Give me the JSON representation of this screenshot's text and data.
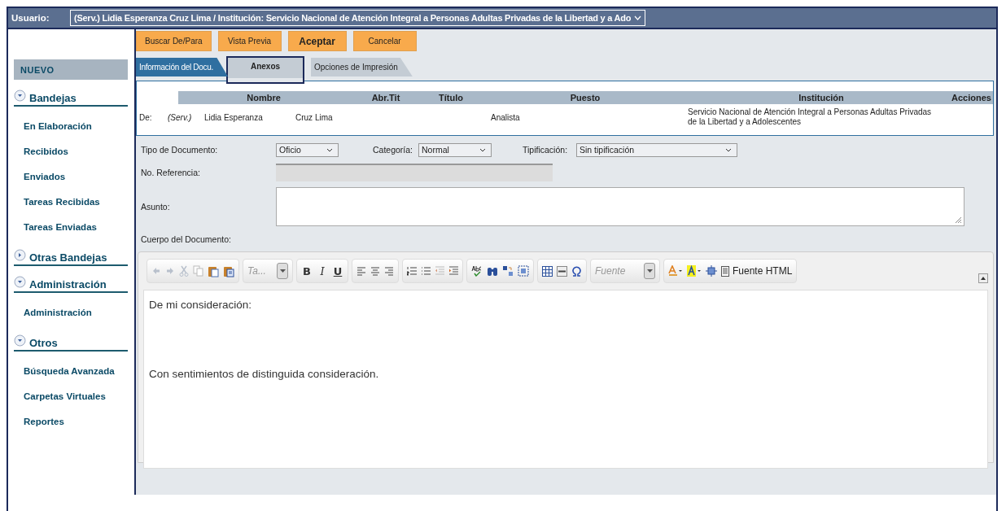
{
  "header": {
    "label": "Usuario:",
    "user_select": "(Serv.) Lidia Esperanza Cruz Lima / Institución: Servicio Nacional de Atención Integral a Personas Adultas Privadas de la Libertad y a Ado"
  },
  "sidebar": {
    "new_button": "NUEVO",
    "sections": [
      {
        "title": "Bandejas",
        "expanded": true,
        "items": [
          "En Elaboración",
          "Recibidos",
          "Enviados",
          "Tareas Recibidas",
          "Tareas Enviadas"
        ]
      },
      {
        "title": "Otras Bandejas",
        "expanded": false
      },
      {
        "title": "Administración",
        "expanded": true,
        "items": [
          "Administración"
        ]
      },
      {
        "title": "Otros",
        "expanded": true,
        "items": [
          "Búsqueda Avanzada",
          "Carpetas Virtuales",
          "Reportes"
        ]
      }
    ]
  },
  "buttons": [
    {
      "label": "Buscar De/Para",
      "kind": "normal"
    },
    {
      "label": "Vista Previa",
      "kind": "normal"
    },
    {
      "label": "Aceptar",
      "kind": "primary"
    },
    {
      "label": "Cancelar",
      "kind": "normal"
    }
  ],
  "tabs": [
    {
      "label": "Información del Docu.",
      "selected": true,
      "outlined": false
    },
    {
      "label": "Anexos",
      "selected": false,
      "outlined": true
    },
    {
      "label": "Opciones de Impresión",
      "selected": false,
      "outlined": false
    }
  ],
  "recipients": {
    "columns": [
      "Nombre",
      "Abr.Tit",
      "Título",
      "Puesto",
      "Institución",
      "Acciones"
    ],
    "rows": [
      {
        "role": "De:",
        "abbrev": "(Serv.)",
        "first_name": "Lidia Esperanza",
        "last_name": "Cruz Lima",
        "puesto": "Analista",
        "institucion": "Servicio Nacional de Atención Integral a Personas Adultas Privadas de la Libertad y a Adolescentes"
      }
    ]
  },
  "form": {
    "tipo_label": "Tipo de Documento:",
    "tipo": "Oficio",
    "categoria_label": "Categoría:",
    "categoria": "Normal",
    "tipificacion_label": "Tipificación:",
    "tipificacion": "Sin tipificación",
    "referencia_label": "No. Referencia:",
    "referencia_disabled": true,
    "asunto_label": "Asunto:",
    "cuerpo_label": "Cuerpo del Documento:"
  },
  "editor": {
    "style_select": "Ta...",
    "bold": "B",
    "italic": "I",
    "underline": "U",
    "font_select": "Fuente",
    "source_button": "Fuente HTML",
    "paragraphs": [
      "De mi consideración:",
      "Con sentimientos de distinguida consideración."
    ]
  }
}
